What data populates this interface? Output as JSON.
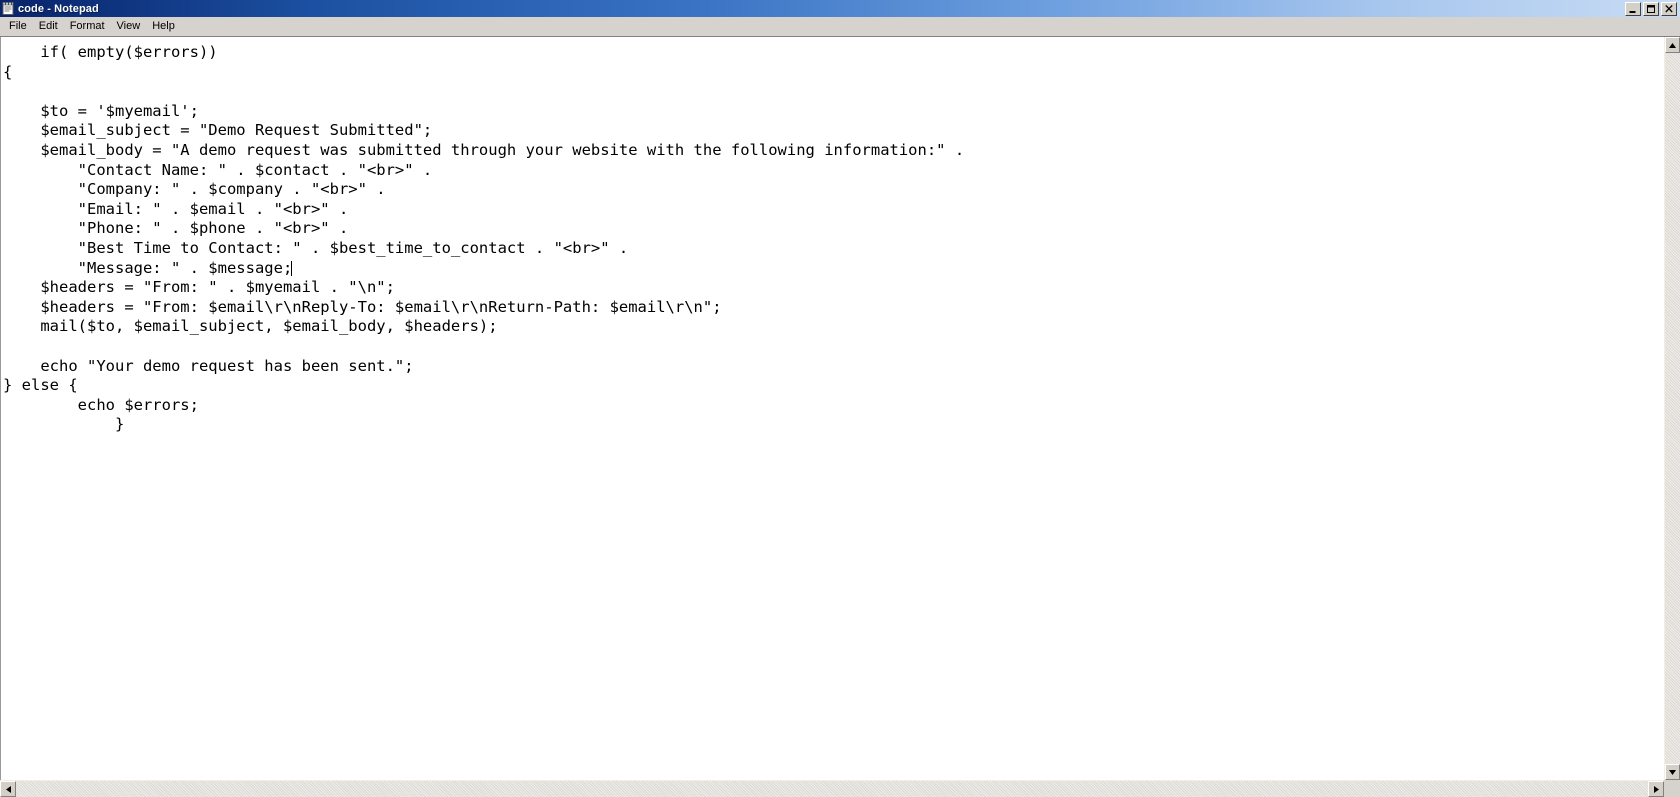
{
  "window": {
    "title": "code - Notepad",
    "icon": "notepad-icon",
    "controls": [
      {
        "name": "minimize-button",
        "glyph": "_"
      },
      {
        "name": "restore-button",
        "glyph": "❐"
      },
      {
        "name": "close-button",
        "glyph": "✕"
      }
    ]
  },
  "menubar": {
    "items": [
      {
        "label": "File"
      },
      {
        "label": "Edit"
      },
      {
        "label": "Format"
      },
      {
        "label": "View"
      },
      {
        "label": "Help"
      }
    ]
  },
  "editor": {
    "language": "php",
    "wordwrap": "off",
    "caret_line": 8,
    "text_color": "#000000",
    "background_color": "#ffffff",
    "content": "    if( empty($errors))\n{\n\n    $to = '$myemail';\n    $email_subject = \"Demo Request Submitted\";\n    $email_body = \"A demo request was submitted through your website with the following information:\" .\n        \"Contact Name: \" . $contact . \"<br>\" .\n        \"Company: \" . $company . \"<br>\" .\n        \"Email: \" . $email . \"<br>\" .\n        \"Phone: \" . $phone . \"<br>\" .\n        \"Best Time to Contact: \" . $best_time_to_contact . \"<br>\" .\n        \"Message: \" . $message;",
    "content_after_caret": "\n    $headers = \"From: \" . $myemail . \"\\n\";\n    $headers = \"From: $email\\r\\nReply-To: $email\\r\\nReturn-Path: $email\\r\\n\";\n    mail($to, $email_subject, $email_body, $headers);\n\n    echo \"Your demo request has been sent.\";\n} else {\n        echo $errors;\n            }"
  },
  "scrollbars": {
    "vertical": {
      "up_arrow": "scroll-up-icon",
      "down_arrow": "scroll-down-icon"
    },
    "horizontal": {
      "left_arrow": "scroll-left-icon",
      "right_arrow": "scroll-right-icon"
    }
  }
}
